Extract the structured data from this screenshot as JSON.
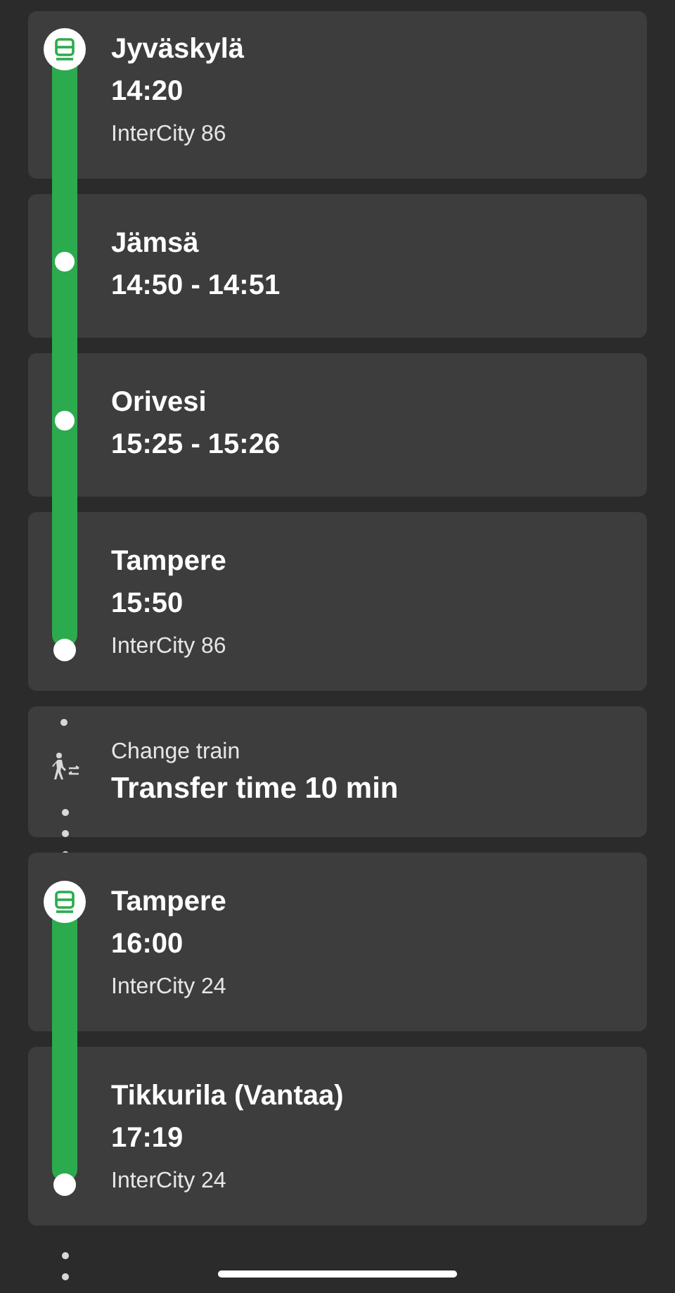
{
  "stops": [
    {
      "kind": "departure",
      "name": "Jyväskylä",
      "time": "14:20",
      "train": "InterCity 86"
    },
    {
      "kind": "intermediate",
      "name": "Jämsä",
      "time": "14:50 - 14:51"
    },
    {
      "kind": "intermediate",
      "name": "Orivesi",
      "time": "15:25 - 15:26"
    },
    {
      "kind": "arrival",
      "name": "Tampere",
      "time": "15:50",
      "train": "InterCity 86"
    },
    {
      "kind": "transfer",
      "label": "Change train",
      "detail": "Transfer time 10 min"
    },
    {
      "kind": "departure",
      "name": "Tampere",
      "time": "16:00",
      "train": "InterCity 24"
    },
    {
      "kind": "arrival",
      "name": "Tikkurila (Vantaa)",
      "time": "17:19",
      "train": "InterCity 24"
    }
  ]
}
